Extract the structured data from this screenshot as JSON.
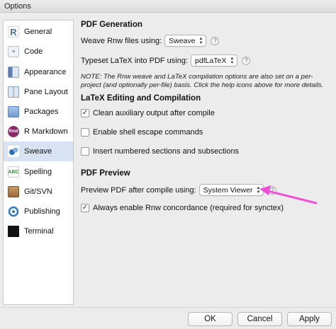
{
  "window": {
    "title": "Options"
  },
  "sidebar": {
    "items": [
      {
        "label": "General",
        "icon": "r-icon",
        "color": "#4a6fa5",
        "selected": false
      },
      {
        "label": "Code",
        "icon": "code-icon",
        "color": "#7a8a99",
        "selected": false
      },
      {
        "label": "Appearance",
        "icon": "appearance-icon",
        "color": "#5b7db1",
        "selected": false
      },
      {
        "label": "Pane Layout",
        "icon": "pane-layout-icon",
        "color": "#8aa0b8",
        "selected": false
      },
      {
        "label": "Packages",
        "icon": "packages-icon",
        "color": "#6f9bd1",
        "selected": false
      },
      {
        "label": "R Markdown",
        "icon": "rmarkdown-icon",
        "color": "#8b2a6b",
        "selected": false
      },
      {
        "label": "Sweave",
        "icon": "sweave-icon",
        "color": "#2f6fb3",
        "selected": true
      },
      {
        "label": "Spelling",
        "icon": "spelling-icon",
        "color": "#3f8f3f",
        "selected": false
      },
      {
        "label": "Git/SVN",
        "icon": "git-svn-icon",
        "color": "#9a6b3a",
        "selected": false
      },
      {
        "label": "Publishing",
        "icon": "publishing-icon",
        "color": "#2c7bbf",
        "selected": false
      },
      {
        "label": "Terminal",
        "icon": "terminal-icon",
        "color": "#111111",
        "selected": false
      }
    ]
  },
  "pdf_generation": {
    "heading": "PDF Generation",
    "weave_label": "Weave Rnw files using:",
    "weave_value": "Sweave",
    "typeset_label": "Typeset LaTeX into PDF using:",
    "typeset_value": "pdfLaTeX",
    "note": "NOTE: The Rnw weave and LaTeX compilation options are also set on a per-project (and optionally per-file) basis. Click the help icons above for more details."
  },
  "latex_editing": {
    "heading": "LaTeX Editing and Compilation",
    "options": [
      {
        "label": "Clean auxiliary output after compile",
        "checked": true
      },
      {
        "label": "Enable shell escape commands",
        "checked": false
      },
      {
        "label": "Insert numbered sections and subsections",
        "checked": false
      }
    ]
  },
  "pdf_preview": {
    "heading": "PDF Preview",
    "preview_label": "Preview PDF after compile using:",
    "preview_value": "System Viewer",
    "concordance_label": "Always enable Rnw concordance (required for synctex)",
    "concordance_checked": true
  },
  "buttons": {
    "ok": "OK",
    "cancel": "Cancel",
    "apply": "Apply"
  },
  "help_glyph": "?",
  "check_glyph": "✓",
  "select_arrows": "▲▼",
  "annotation_color": "#f04fd6"
}
